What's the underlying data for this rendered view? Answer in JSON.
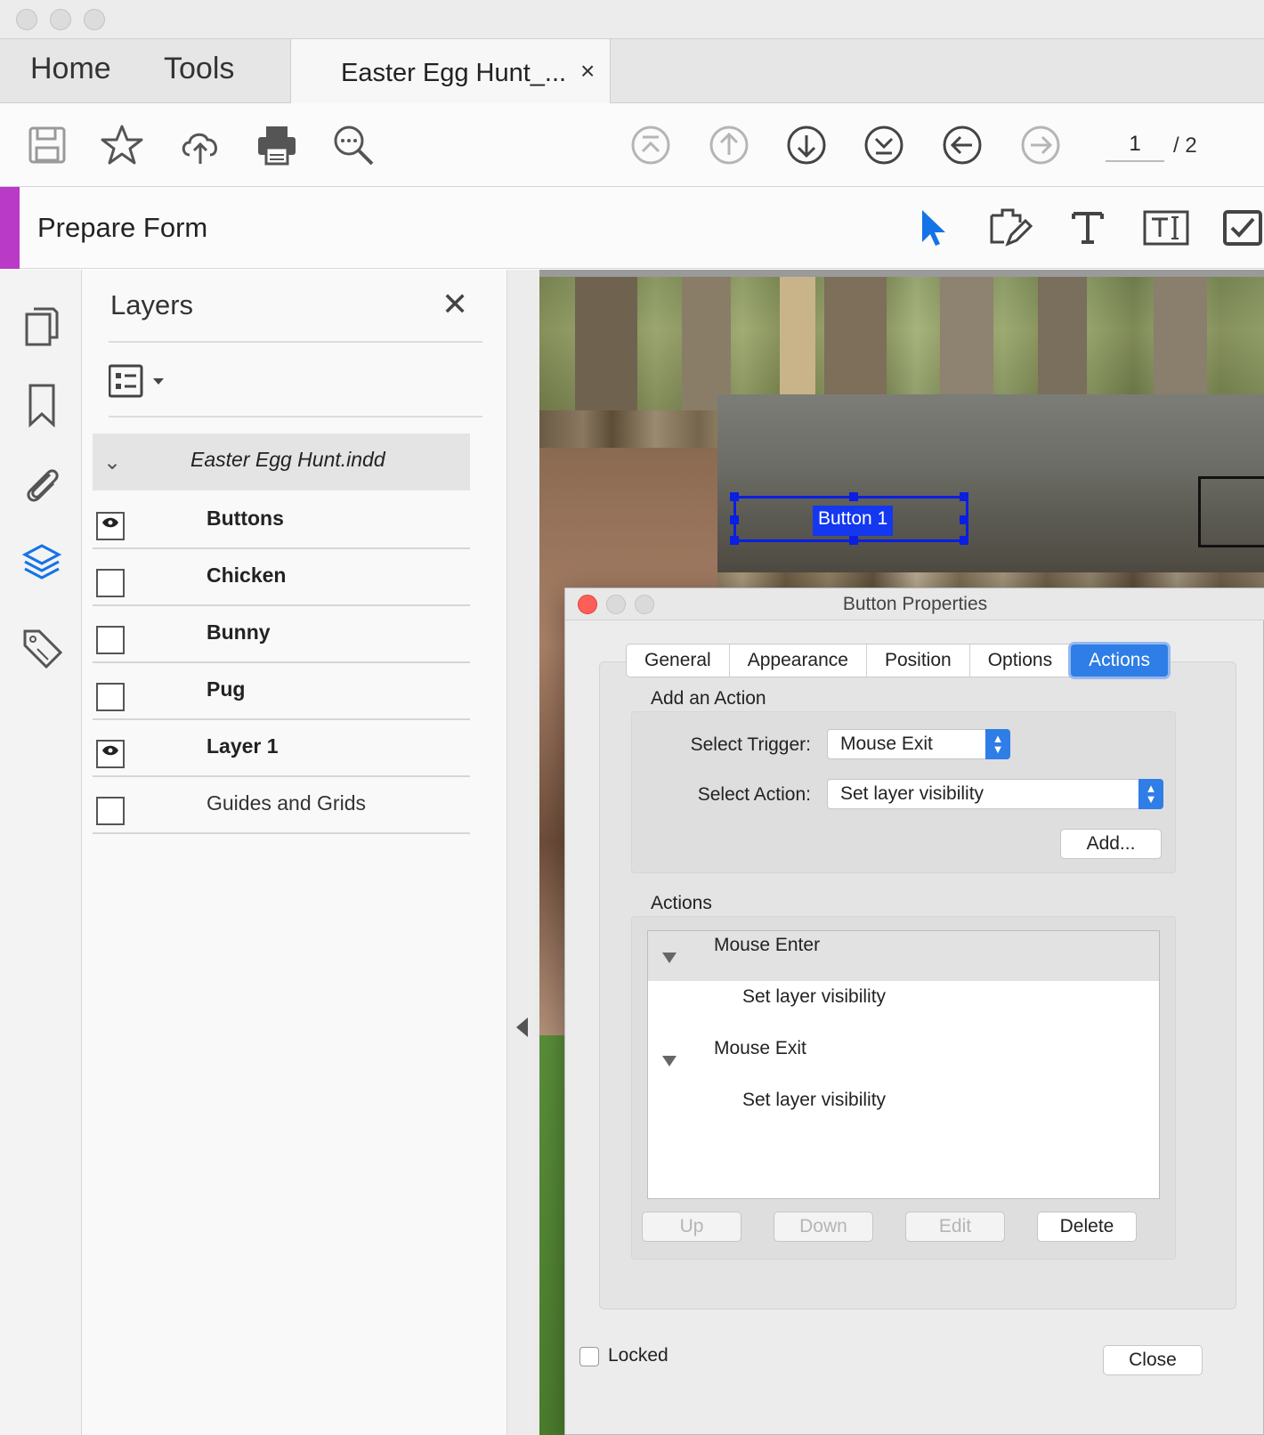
{
  "window": {
    "tabs": {
      "home": "Home",
      "tools": "Tools"
    },
    "document_tab": {
      "title": "Easter Egg Hunt_...",
      "close": "×"
    }
  },
  "toolbar": {
    "icons": [
      "save-icon",
      "bookmark-star-icon",
      "upload-cloud-icon",
      "print-icon",
      "search-zoom-icon",
      "first-page-icon",
      "previous-page-icon",
      "next-page-icon",
      "last-page-icon",
      "back-icon",
      "forward-icon"
    ],
    "page_current": "1",
    "page_total": "/ 2"
  },
  "prepare_form": {
    "title": "Prepare Form",
    "accent_color": "#b83ac7",
    "tools": [
      "select-pointer-icon",
      "edit-field-icon",
      "text-field-icon",
      "text-box-field-icon",
      "checkbox-field-icon"
    ]
  },
  "left_rail": {
    "icons": [
      "pages-icon",
      "bookmark-icon",
      "attachment-icon",
      "layers-icon",
      "tag-icon"
    ],
    "active": "layers-icon",
    "active_color": "#1473e6"
  },
  "layers_panel": {
    "title": "Layers",
    "close": "✕",
    "document": "Easter Egg Hunt.indd",
    "layers": [
      {
        "name": "Buttons",
        "visible": true,
        "bold": true
      },
      {
        "name": "Chicken",
        "visible": false,
        "bold": true
      },
      {
        "name": "Bunny",
        "visible": false,
        "bold": true
      },
      {
        "name": "Pug",
        "visible": false,
        "bold": true
      },
      {
        "name": "Layer 1",
        "visible": true,
        "bold": true
      },
      {
        "name": "Guides and Grids",
        "visible": false,
        "bold": false
      }
    ]
  },
  "canvas": {
    "button_label": "Button 1",
    "selection_color": "#0a1fe0"
  },
  "dialog": {
    "title": "Button Properties",
    "tabs": [
      "General",
      "Appearance",
      "Position",
      "Options",
      "Actions"
    ],
    "active_tab": "Actions",
    "add_action": {
      "heading": "Add an Action",
      "trigger_label": "Select Trigger:",
      "trigger_value": "Mouse Exit",
      "action_label": "Select Action:",
      "action_value": "Set layer visibility",
      "add_button": "Add..."
    },
    "actions": {
      "heading": "Actions",
      "items": [
        {
          "trigger": "Mouse Enter",
          "action": "Set layer visibility"
        },
        {
          "trigger": "Mouse Exit",
          "action": "Set layer visibility"
        }
      ],
      "buttons": {
        "up": "Up",
        "down": "Down",
        "edit": "Edit",
        "delete": "Delete"
      }
    },
    "locked_label": "Locked",
    "close_button": "Close",
    "accent_color": "#2f7de6"
  }
}
